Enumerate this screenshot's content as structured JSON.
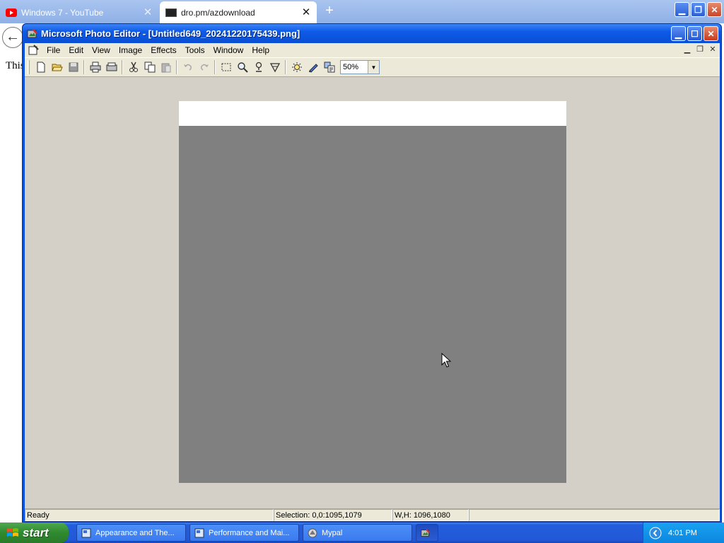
{
  "browser": {
    "tabs": [
      {
        "label": "Windows 7 - YouTube"
      },
      {
        "label": "dro.pm/azdownload"
      }
    ],
    "new_tab_glyph": "+",
    "back_glyph": "←",
    "page_text": "This"
  },
  "editor": {
    "title": "Microsoft Photo Editor - [Untitled649_20241220175439.png]",
    "menu": [
      "File",
      "Edit",
      "View",
      "Image",
      "Effects",
      "Tools",
      "Window",
      "Help"
    ],
    "toolbar_icons": [
      "new-icon",
      "open-icon",
      "save-icon",
      "print-icon",
      "scan-icon",
      "cut-icon",
      "copy-icon",
      "paste-icon",
      "undo-icon",
      "redo-icon",
      "select-icon",
      "zoom-icon",
      "smudge-icon",
      "transparent-icon",
      "balance-icon",
      "sharpen-icon",
      "properties-icon"
    ],
    "zoom": "50%",
    "status": {
      "ready": "Ready",
      "selection": "Selection: 0,0:1095,1079",
      "size": "W,H: 1096,1080"
    },
    "colors": {
      "workspace": "#d4d0c8",
      "canvas_gray": "#808080",
      "canvas_strip": "#ffffff"
    }
  },
  "taskbar": {
    "start_label": "start",
    "tasks": [
      {
        "label": "Appearance and The..."
      },
      {
        "label": "Performance and Mai..."
      },
      {
        "label": "Mypal"
      }
    ],
    "clock": "4:01 PM"
  }
}
